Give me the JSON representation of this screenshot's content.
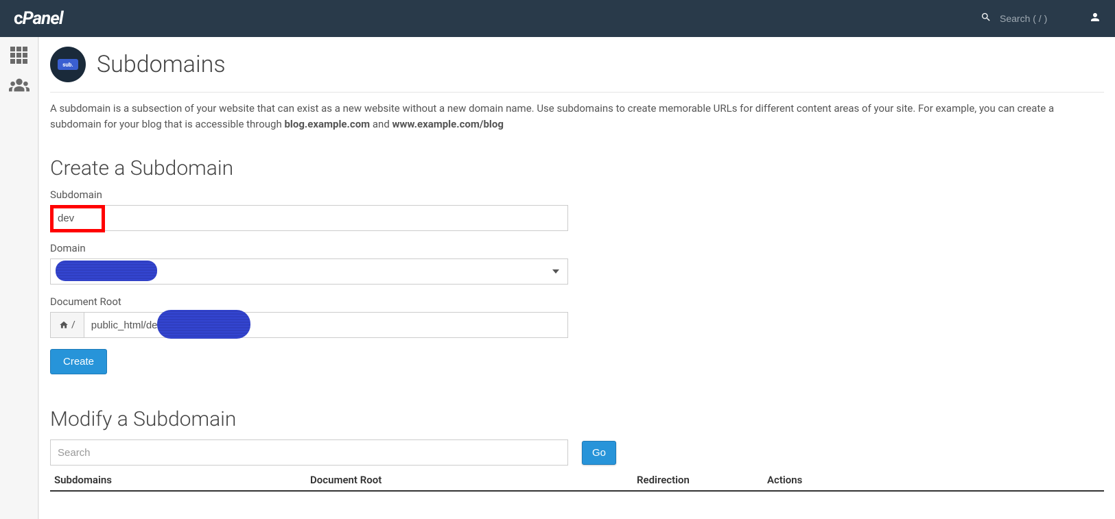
{
  "header": {
    "logo_text": "cPanel",
    "search_placeholder": "Search ( / )"
  },
  "page": {
    "icon_label": "sub.",
    "title": "Subdomains",
    "description_pre": "A subdomain is a subsection of your website that can exist as a new website without a new domain name. Use subdomains to create memorable URLs for different content areas of your site. For example, you can create a subdomain for your blog that is accessible through ",
    "description_bold1": "blog.example.com",
    "description_mid": " and ",
    "description_bold2": "www.example.com/blog"
  },
  "create": {
    "heading": "Create a Subdomain",
    "subdomain_label": "Subdomain",
    "subdomain_value": "dev",
    "domain_label": "Domain",
    "domain_value": "",
    "docroot_label": "Document Root",
    "docroot_addon": "/",
    "docroot_value": "public_html/dev",
    "button": "Create"
  },
  "modify": {
    "heading": "Modify a Subdomain",
    "search_placeholder": "Search",
    "go_button": "Go",
    "columns": {
      "subdomains": "Subdomains",
      "document_root": "Document Root",
      "redirection": "Redirection",
      "actions": "Actions"
    }
  }
}
